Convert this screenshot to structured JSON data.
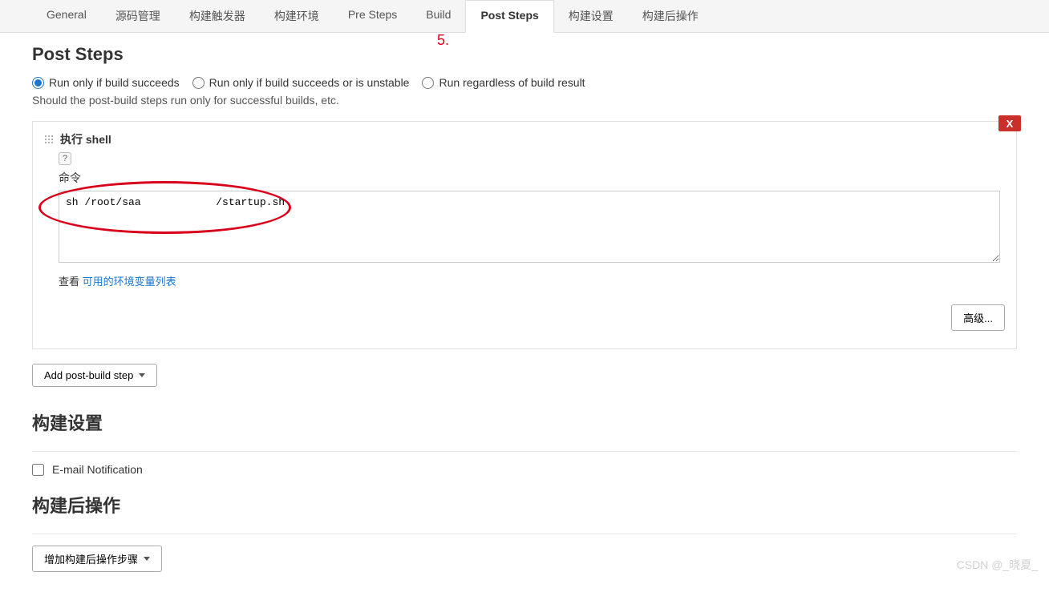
{
  "tabs": [
    {
      "label": "General"
    },
    {
      "label": "源码管理"
    },
    {
      "label": "构建触发器"
    },
    {
      "label": "构建环境"
    },
    {
      "label": "Pre Steps"
    },
    {
      "label": "Build"
    },
    {
      "label": "Post Steps",
      "active": true
    },
    {
      "label": "构建设置"
    },
    {
      "label": "构建后操作"
    }
  ],
  "annotation_number": "5.",
  "post_steps": {
    "title": "Post Steps",
    "radios": {
      "r1": "Run only if build succeeds",
      "r2": "Run only if build succeeds or is unstable",
      "r3": "Run regardless of build result"
    },
    "help_text": "Should the post-build steps run only for successful builds, etc.",
    "shell": {
      "title": "执行 shell",
      "help_icon": "?",
      "cmd_label": "命令",
      "cmd_value_part1": "sh /root/sa",
      "cmd_value_part2": "/startup.sh",
      "cmd_full": "sh /root/saa            /startup.sh",
      "see_prefix": "查看 ",
      "see_link": "可用的环境变量列表",
      "delete_label": "X",
      "advanced_btn": "高级..."
    },
    "add_step_btn": "Add post-build step"
  },
  "build_settings": {
    "title": "构建设置",
    "email_label": "E-mail Notification"
  },
  "post_build": {
    "title": "构建后操作",
    "add_btn": "增加构建后操作步骤"
  },
  "watermark": "CSDN @_晓夏_"
}
